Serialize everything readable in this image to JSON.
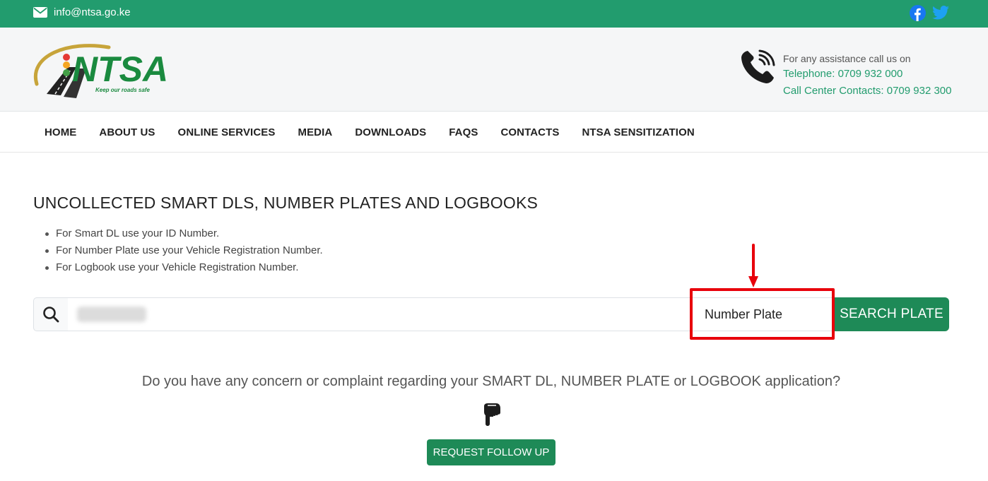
{
  "topbar": {
    "email": "info@ntsa.go.ke",
    "icons": [
      "envelope-icon",
      "facebook-icon",
      "twitter-icon"
    ]
  },
  "logo": {
    "text": "NTSA",
    "tagline": "Keep our roads safe"
  },
  "contact": {
    "line1": "For any assistance call us on",
    "telephone": "Telephone: 0709 932 000",
    "call_center": "Call Center Contacts: 0709 932 300",
    "icon": "phone-icon"
  },
  "nav": {
    "items": [
      "HOME",
      "ABOUT US",
      "ONLINE SERVICES",
      "MEDIA",
      "DOWNLOADS",
      "FAQS",
      "CONTACTS",
      "NTSA SENSITIZATION"
    ]
  },
  "main": {
    "title": "UNCOLLECTED SMART DLS, NUMBER PLATES AND LOGBOOKS",
    "bullets": [
      "For Smart DL use your ID Number.",
      "For Number Plate use your Vehicle Registration Number.",
      "For Logbook use your Vehicle Registration Number."
    ],
    "search": {
      "value": "",
      "type_selected": "Number Plate",
      "button": "SEARCH PLATE"
    },
    "concern_text": "Do you have any concern or complaint regarding your SMART DL, NUMBER PLATE or LOGBOOK application?",
    "followup_button": "REQUEST FOLLOW UP"
  },
  "colors": {
    "topbar": "#229c6e",
    "button": "#1e8a57",
    "annotation": "#e8000b",
    "link": "#229c6e"
  }
}
